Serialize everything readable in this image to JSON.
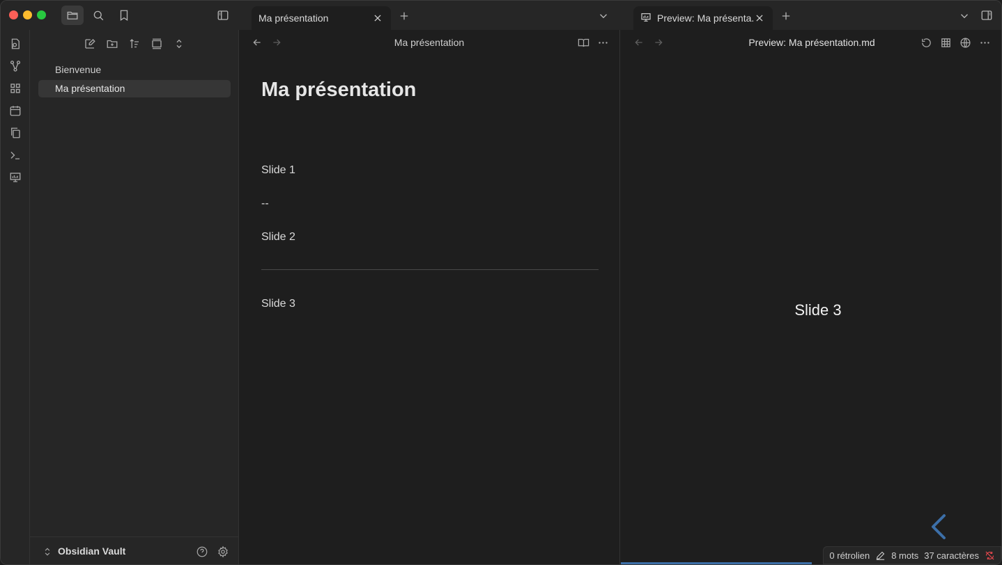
{
  "window": {
    "left_tab": {
      "label": "Ma présentation"
    },
    "right_tab": {
      "label": "Preview: Ma présenta..."
    }
  },
  "sidebar": {
    "files": [
      {
        "label": "Bienvenue",
        "selected": false
      },
      {
        "label": "Ma présentation",
        "selected": true
      }
    ],
    "vault_name": "Obsidian Vault"
  },
  "editor": {
    "title": "Ma présentation",
    "heading": "Ma présentation",
    "lines": [
      "Slide 1",
      "--",
      "Slide 2",
      "Slide 3"
    ]
  },
  "preview": {
    "title": "Preview: Ma présentation.md",
    "slide_text": "Slide 3",
    "progress": 0.5
  },
  "status": {
    "backlinks": "0 rétrolien",
    "words": "8 mots",
    "chars": "37 caractères"
  },
  "colors": {
    "accent": "#3c6fa8",
    "sync_error": "#e5484d"
  }
}
